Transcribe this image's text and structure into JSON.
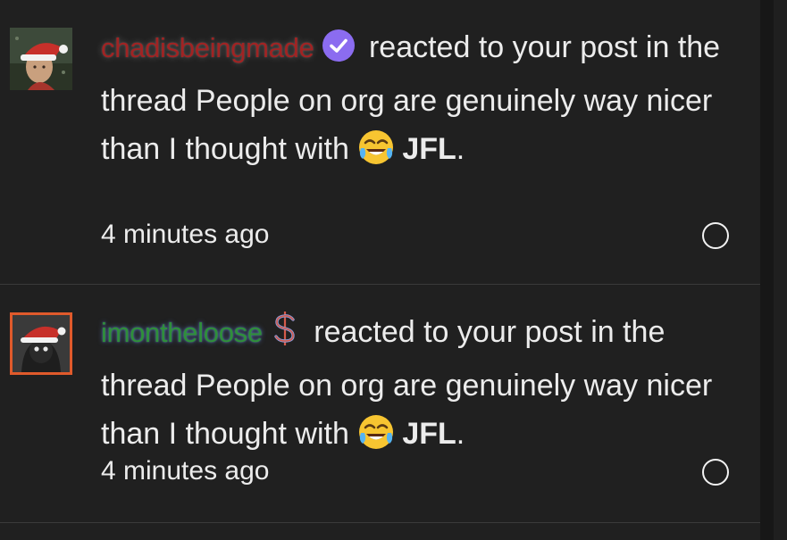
{
  "alerts": [
    {
      "username": "chadisbeingmade",
      "user_color": "#a12323",
      "badge_icon": "verified-check-icon",
      "badge_color": "#8b6cf0",
      "action_text": "reacted to your post in the thread People on org are genuinely way nicer than I thought with",
      "reaction_icon": "crying-laughing-emoji-icon",
      "reaction_name": "JFL",
      "trailing_punct": ".",
      "time": "4 minutes ago",
      "avatar_icon": "santa-hat-avatar"
    },
    {
      "username": "imontheloose",
      "user_color": "#2f8f3a",
      "badge_icon": "dollar-sign-icon",
      "badge_color": "#d45a4a",
      "action_text": "reacted to your post in the thread People on org are genuinely way nicer than I thought with",
      "reaction_icon": "crying-laughing-emoji-icon",
      "reaction_name": "JFL",
      "trailing_punct": ".",
      "time": "4 minutes ago",
      "avatar_icon": "santa-hat-avatar",
      "avatar_border_color": "#e05a2b"
    }
  ]
}
